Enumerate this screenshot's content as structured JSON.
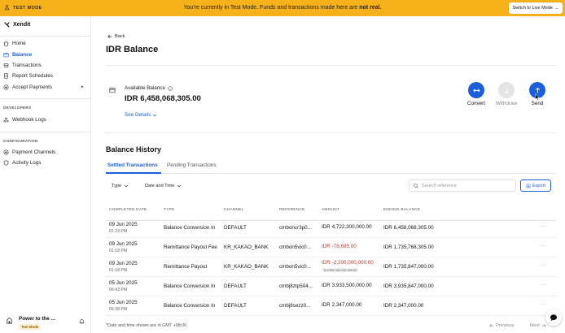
{
  "banner": {
    "mode_label": "TEST MODE",
    "message_prefix": "You're currently in Test Mode. Funds and transactions made here are ",
    "message_bold": "not real.",
    "switch_label": "Switch to Live Mode",
    "switch_arrow": "→",
    "color": "#f7b21b"
  },
  "sidebar": {
    "brand": "Xendit",
    "items": [
      {
        "label": "Home",
        "icon": "home-icon"
      },
      {
        "label": "Balance",
        "icon": "wallet-icon",
        "active": true
      },
      {
        "label": "Transactions",
        "icon": "transactions-icon"
      },
      {
        "label": "Report Schedules",
        "icon": "document-icon"
      },
      {
        "label": "Accept Payments",
        "icon": "plus-circle-icon",
        "caret": "▸"
      }
    ],
    "developers_label": "DEVELOPERS",
    "developers_items": [
      {
        "label": "Webhook Logs",
        "icon": "webhook-icon"
      }
    ],
    "configuration_label": "CONFIGURATION",
    "configuration_items": [
      {
        "label": "Payment Channels",
        "icon": "plus-circle-icon"
      },
      {
        "label": "Activity Logs",
        "icon": "shield-icon"
      }
    ],
    "footer": {
      "org_name": "Power to the ...",
      "badge": "Test Mode"
    }
  },
  "page": {
    "back_label": "Back",
    "title": "IDR Balance",
    "balance_label": "Available Balance",
    "balance_amount": "IDR 6,458,068,305.00",
    "see_details": "See Details",
    "actions": [
      {
        "label": "Convert",
        "icon": "convert-icon",
        "state": "enabled"
      },
      {
        "label": "Withdraw",
        "icon": "arrow-down-icon",
        "state": "disabled"
      },
      {
        "label": "Send",
        "icon": "arrow-up-icon",
        "state": "enabled"
      }
    ],
    "accent_color": "#1a5fdc"
  },
  "history": {
    "title": "Balance History",
    "tabs": [
      {
        "label": "Settled Transactions",
        "active": true
      },
      {
        "label": "Pending Transactions",
        "active": false
      }
    ],
    "filters": {
      "type_label": "Type",
      "date_label": "Date and Time"
    },
    "search_placeholder": "Search reference",
    "export_label": "Export",
    "columns": [
      "COMPLETED DATE",
      "TYPE",
      "CHANNEL",
      "REFERENCE",
      "AMOUNT",
      "ENDING BALANCE"
    ],
    "rows": [
      {
        "date": "09 Jun 2025",
        "time": "01:23 PM",
        "type": "Balance Conversion In",
        "channel": "DEFAULT",
        "reference": "cmboncr3p0...",
        "amount": "IDR 4,722,300,000.00",
        "negative": false,
        "note": "",
        "ending": "IDR 6,458,068,305.00"
      },
      {
        "date": "09 Jun 2025",
        "time": "01:18 PM",
        "type": "Remittance Payout Fee",
        "channel": "KR_KAKAO_BANK",
        "reference": "cmbon5vic0...",
        "amount": "IDR -78,695.00",
        "negative": true,
        "note": "",
        "ending": "IDR 1,735,768,305.00"
      },
      {
        "date": "09 Jun 2025",
        "time": "01:18 PM",
        "type": "Remittance Payout",
        "channel": "KR_KAKAO_BANK",
        "reference": "cmbon5vic0...",
        "amount": "IDR -2,200,000,000.00",
        "negative": true,
        "note": "To KRW 200,000,000.00",
        "ending": "IDR 1,735,847,000.00"
      },
      {
        "date": "05 Jun 2025",
        "time": "06:43 PM",
        "type": "Balance Conversion In",
        "channel": "DEFAULT",
        "reference": "cmbj8ztp504...",
        "amount": "IDR 3,933,500,000.00",
        "negative": false,
        "note": "",
        "ending": "IDR 3,935,847,000.00"
      },
      {
        "date": "05 Jun 2025",
        "time": "06:38 PM",
        "type": "Balance Conversion In",
        "channel": "DEFAULT",
        "reference": "cmbj8sezz0...",
        "amount": "IDR 2,347,000.00",
        "negative": false,
        "note": "",
        "ending": "IDR 2,347,000.00"
      }
    ],
    "row_menu": "···",
    "footnote": "*Date and time shown are in GMT +08:00",
    "prev_label": "Previous",
    "next_label": "Next"
  }
}
